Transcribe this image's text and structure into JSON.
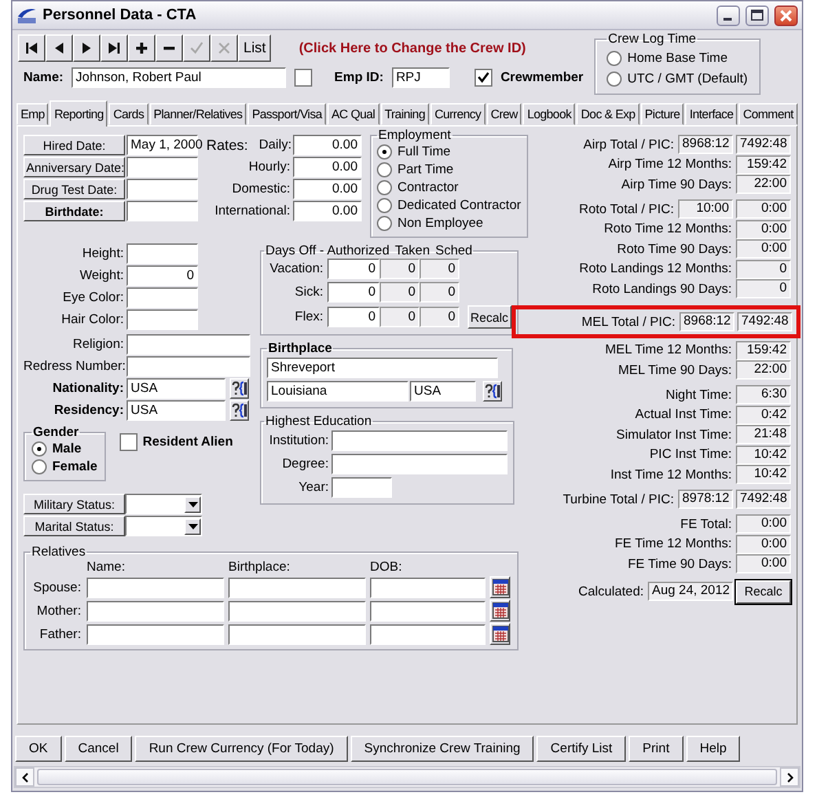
{
  "window": {
    "title": "Personnel Data - CTA"
  },
  "toolbar": {
    "buttons": [
      {
        "kind": "first",
        "disabled": false
      },
      {
        "kind": "prev",
        "disabled": false
      },
      {
        "kind": "next",
        "disabled": false
      },
      {
        "kind": "last",
        "disabled": false
      },
      {
        "kind": "add",
        "disabled": false
      },
      {
        "kind": "remove",
        "disabled": false
      },
      {
        "kind": "confirm",
        "disabled": true
      },
      {
        "kind": "cancel",
        "disabled": true
      },
      {
        "kind": "text",
        "label": "List",
        "disabled": false
      }
    ],
    "crew_id_link": "(Click Here to Change the Crew ID)"
  },
  "crew_log_time": {
    "title": "Crew Log Time",
    "options": [
      {
        "label": "Home Base Time",
        "selected": false
      },
      {
        "label": "UTC / GMT (Default)",
        "selected": false
      }
    ]
  },
  "identity": {
    "name_label": "Name:",
    "name": "Johnson, Robert Paul",
    "flag_checked": false,
    "emp_id_label": "Emp ID:",
    "emp_id": "RPJ",
    "crewmember": {
      "label": "Crewmember",
      "checked": true
    }
  },
  "tabs": [
    {
      "label": "Emp",
      "selected": false
    },
    {
      "label": "Reporting",
      "selected": true
    },
    {
      "label": "Cards",
      "selected": false
    },
    {
      "label": "Planner/Relatives",
      "selected": false
    },
    {
      "label": "Passport/Visa",
      "selected": false
    },
    {
      "label": "AC Qual",
      "selected": false
    },
    {
      "label": "Training",
      "selected": false
    },
    {
      "label": "Currency",
      "selected": false
    },
    {
      "label": "Crew",
      "selected": false
    },
    {
      "label": "Logbook",
      "selected": false
    },
    {
      "label": "Doc & Exp",
      "selected": false
    },
    {
      "label": "Picture",
      "selected": false
    },
    {
      "label": "Interface",
      "selected": false
    },
    {
      "label": "Comment",
      "selected": false
    }
  ],
  "dates": [
    {
      "label": "Hired Date:",
      "value": "May 1, 2000",
      "required": false
    },
    {
      "label": "Anniversary Date:",
      "required": false
    },
    {
      "label": "Drug Test Date:",
      "required": false
    },
    {
      "label": "Birthdate:",
      "required": true
    }
  ],
  "rates": {
    "title": "Rates:",
    "items": [
      {
        "label": "Daily:",
        "value": "0.00"
      },
      {
        "label": "Hourly:",
        "value": "0.00"
      },
      {
        "label": "Domestic:",
        "value": "0.00"
      },
      {
        "label": "International:",
        "value": "0.00"
      }
    ]
  },
  "employment": {
    "title": "Employment",
    "options": [
      {
        "label": "Full Time",
        "selected": true
      },
      {
        "label": "Part Time",
        "selected": false
      },
      {
        "label": "Contractor",
        "selected": false
      },
      {
        "label": "Dedicated Contractor",
        "selected": false
      },
      {
        "label": "Non Employee",
        "selected": false
      }
    ]
  },
  "attributes": [
    {
      "label": "Height:"
    },
    {
      "label": "Weight:",
      "value": "0"
    },
    {
      "label": "Eye Color:"
    },
    {
      "label": "Hair Color:"
    }
  ],
  "origin": [
    {
      "label": "Religion:",
      "kind": "text",
      "required": false
    },
    {
      "label": "Redress Number:",
      "kind": "text",
      "required": false
    },
    {
      "label": "Nationality:",
      "value": "USA",
      "kind": "lookup",
      "required": true
    },
    {
      "label": "Residency:",
      "value": "USA",
      "kind": "lookup",
      "required": true
    }
  ],
  "gender": {
    "title": "Gender",
    "options": [
      {
        "label": "Male",
        "selected": true
      },
      {
        "label": "Female",
        "selected": false
      }
    ]
  },
  "resident_alien": {
    "label": "Resident Alien",
    "checked": false
  },
  "status_fields": [
    {
      "label": "Military Status:"
    },
    {
      "label": "Marital Status:"
    }
  ],
  "days_off": {
    "title": "Days Off - Authorized",
    "columns": [
      "Taken",
      "Sched"
    ],
    "button": "Recalc",
    "rows": [
      {
        "label": "Vacation:",
        "authorized": "0",
        "taken": "0",
        "sched": "0"
      },
      {
        "label": "Sick:",
        "authorized": "0",
        "taken": "0",
        "sched": "0"
      },
      {
        "label": "Flex:",
        "authorized": "0",
        "taken": "0",
        "sched": "0"
      }
    ]
  },
  "birthplace": {
    "title": "Birthplace",
    "city": "Shreveport",
    "state": "Louisiana",
    "country": "USA"
  },
  "education": {
    "title": "Highest Education",
    "fields": [
      {
        "label": "Institution:"
      },
      {
        "label": "Degree:"
      },
      {
        "label": "Year:"
      }
    ]
  },
  "relatives": {
    "title": "Relatives",
    "columns": [
      "Name:",
      "Birthplace:",
      "DOB:"
    ],
    "rows": [
      {
        "label": "Spouse:"
      },
      {
        "label": "Mother:"
      },
      {
        "label": "Father:"
      }
    ]
  },
  "totals": [
    [
      {
        "label": "Airp Total / PIC:",
        "values": [
          "8968:12",
          "7492:48"
        ],
        "highlighted": false
      },
      {
        "label": "Airp Time 12 Months:",
        "values": [
          "159:42"
        ],
        "highlighted": false
      },
      {
        "label": "Airp Time 90 Days:",
        "values": [
          "22:00"
        ],
        "highlighted": false
      }
    ],
    [
      {
        "label": "Roto Total / PIC:",
        "values": [
          "10:00",
          "0:00"
        ],
        "highlighted": false
      },
      {
        "label": "Roto Time 12 Months:",
        "values": [
          "0:00"
        ],
        "highlighted": false
      },
      {
        "label": "Roto Time 90 Days:",
        "values": [
          "0:00"
        ],
        "highlighted": false
      },
      {
        "label": "Roto Landings 12 Months:",
        "values": [
          "0"
        ],
        "highlighted": false
      },
      {
        "label": "Roto Landings 90 Days:",
        "values": [
          "0"
        ],
        "highlighted": false
      }
    ],
    [
      {
        "label": "MEL Total / PIC:",
        "values": [
          "8968:12",
          "7492:48"
        ],
        "highlighted": true
      },
      {
        "label": "MEL Time 12 Months:",
        "values": [
          "159:42"
        ],
        "highlighted": false
      },
      {
        "label": "MEL Time 90 Days:",
        "values": [
          "22:00"
        ],
        "highlighted": false
      }
    ],
    [
      {
        "label": "Night Time:",
        "values": [
          "6:30"
        ],
        "highlighted": false
      },
      {
        "label": "Actual Inst Time:",
        "values": [
          "0:42"
        ],
        "highlighted": false
      },
      {
        "label": "Simulator Inst Time:",
        "values": [
          "21:48"
        ],
        "highlighted": false
      },
      {
        "label": "PIC Inst Time:",
        "values": [
          "10:42"
        ],
        "highlighted": false
      },
      {
        "label": "Inst Time 12 Months:",
        "values": [
          "10:42"
        ],
        "highlighted": false
      }
    ],
    [
      {
        "label": "Turbine Total / PIC:",
        "values": [
          "8978:12",
          "7492:48"
        ],
        "highlighted": false
      }
    ],
    [
      {
        "label": "FE Total:",
        "values": [
          "0:00"
        ],
        "highlighted": false
      },
      {
        "label": "FE Time 12 Months:",
        "values": [
          "0:00"
        ],
        "highlighted": false
      },
      {
        "label": "FE Time 90 Days:",
        "values": [
          "0:00"
        ],
        "highlighted": false
      }
    ]
  ],
  "calculated": {
    "label": "Calculated:",
    "value": "Aug 24, 2012",
    "button": "Recalc"
  },
  "bottom_buttons": [
    "OK",
    "Cancel",
    "Run Crew Currency (For Today)",
    "Synchronize Crew Training",
    "Certify List",
    "Print",
    "Help"
  ]
}
